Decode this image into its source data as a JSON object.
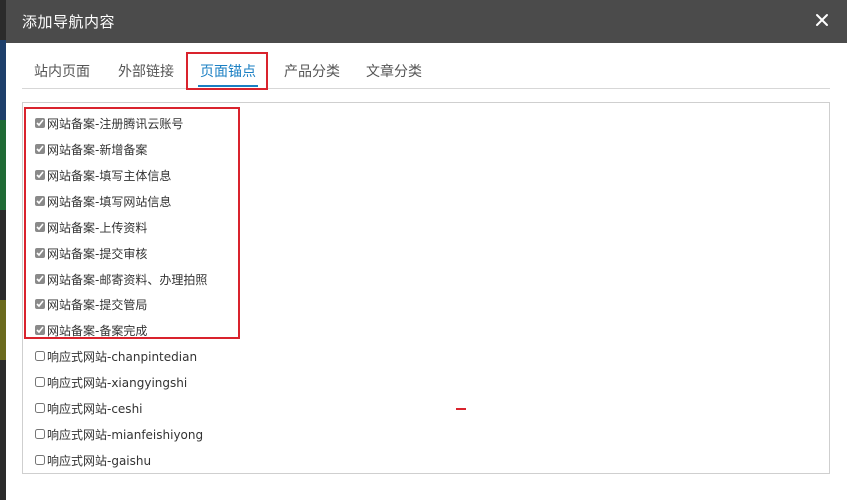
{
  "window": {
    "title": "添加导航内容",
    "close_icon": "close-icon"
  },
  "colors": {
    "titlebar": "#4b4b4b",
    "accent": "#1a7fc3",
    "highlight": "#d9232d"
  },
  "tabs": [
    {
      "label": "站内页面",
      "active": false
    },
    {
      "label": "外部链接",
      "active": false
    },
    {
      "label": "页面锚点",
      "active": true
    },
    {
      "label": "产品分类",
      "active": false
    },
    {
      "label": "文章分类",
      "active": false
    }
  ],
  "items": [
    {
      "label": "网站备案-注册腾讯云账号",
      "checked": true
    },
    {
      "label": "网站备案-新增备案",
      "checked": true
    },
    {
      "label": "网站备案-填写主体信息",
      "checked": true
    },
    {
      "label": "网站备案-填写网站信息",
      "checked": true
    },
    {
      "label": "网站备案-上传资料",
      "checked": true
    },
    {
      "label": "网站备案-提交审核",
      "checked": true
    },
    {
      "label": "网站备案-邮寄资料、办理拍照",
      "checked": true
    },
    {
      "label": "网站备案-提交管局",
      "checked": true
    },
    {
      "label": "网站备案-备案完成",
      "checked": true
    },
    {
      "label": "响应式网站-chanpintedian",
      "checked": false
    },
    {
      "label": "响应式网站-xiangyingshi",
      "checked": false
    },
    {
      "label": "响应式网站-ceshi",
      "checked": false
    },
    {
      "label": "响应式网站-mianfeishiyong",
      "checked": false
    },
    {
      "label": "响应式网站-gaishu",
      "checked": false
    }
  ]
}
